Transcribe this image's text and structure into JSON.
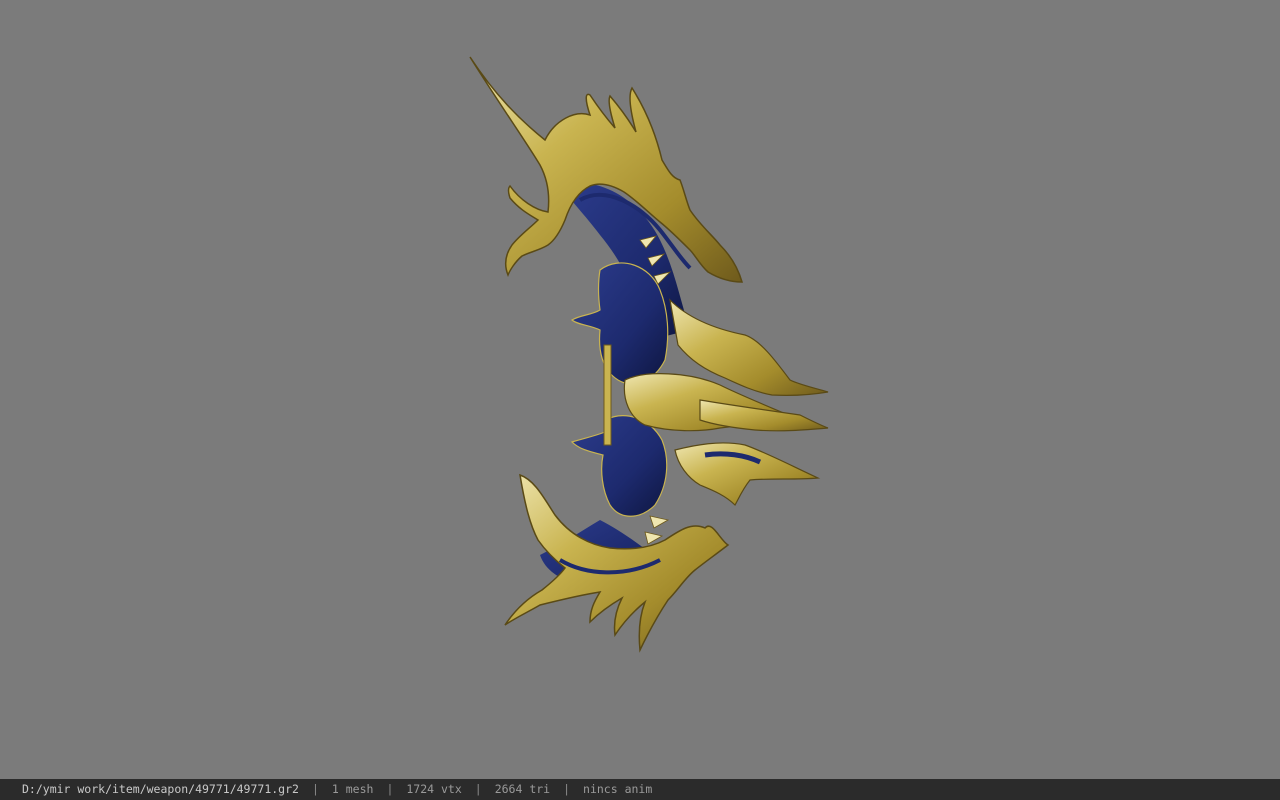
{
  "viewer": {
    "background_color": "#7b7b7b",
    "model_description": "bow",
    "model_colors": {
      "gold": "#c9b450",
      "gold_highlight": "#efe6b0",
      "gold_shadow": "#6e5a1c",
      "blue": "#1d2a6e",
      "blue_dark": "#0e1640"
    }
  },
  "statusbar": {
    "file_path": "D:/ymir work/item/weapon/49771/49771.gr2",
    "mesh_count": "1 mesh",
    "vertex_count": "1724 vtx",
    "triangle_count": "2664 tri",
    "anim_status": "nincs anim",
    "separator": "|"
  }
}
